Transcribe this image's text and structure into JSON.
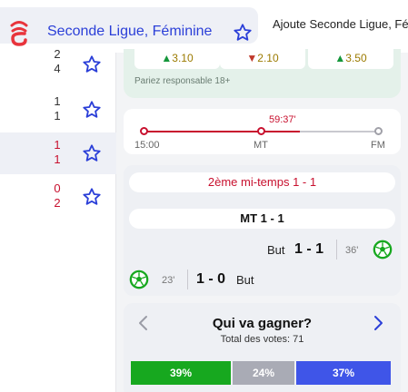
{
  "header": {
    "league_name": "Seconde Ligue, Féminine",
    "add_league": "Ajoute Seconde Ligue, Fém",
    "colors": {
      "brand": "#e8343c",
      "accent": "#2b3fd8"
    }
  },
  "match_list": [
    {
      "home": "2",
      "away": "4",
      "home_color": "#333333",
      "away_color": "#333333",
      "active": false
    },
    {
      "home": "1",
      "away": "1",
      "home_color": "#333333",
      "away_color": "#333333",
      "active": false
    },
    {
      "home": "1",
      "away": "1",
      "home_color": "#c8102e",
      "away_color": "#c8102e",
      "active": true
    },
    {
      "home": "0",
      "away": "2",
      "home_color": "#c8102e",
      "away_color": "#c8102e",
      "active": false
    }
  ],
  "odds": {
    "home": {
      "value": "3.10",
      "trend": "up"
    },
    "draw": {
      "value": "2.10",
      "trend": "down"
    },
    "away": {
      "value": "3.50",
      "trend": "up"
    },
    "responsible": "Pariez responsable 18+"
  },
  "timeline": {
    "current_time": "59:37'",
    "progress": 0.66,
    "labels": {
      "start": "15:00",
      "half": "MT",
      "end": "FM"
    }
  },
  "events": {
    "second_half": "2ème mi-temps 1 - 1",
    "half_time": "MT 1 - 1",
    "goal_away": {
      "label": "But",
      "score": "1 - 1",
      "minute": "36'"
    },
    "goal_home": {
      "label": "But",
      "score": "1 - 0",
      "minute": "23'"
    }
  },
  "poll": {
    "title": "Qui va gagner?",
    "subtitle": "Total des votes: 71",
    "home": {
      "pct": "39%",
      "value": 39,
      "color": "#17a81f"
    },
    "draw": {
      "pct": "24%",
      "value": 24,
      "color": "#a9abb5"
    },
    "away": {
      "pct": "37%",
      "value": 37,
      "color": "#3f55e8"
    }
  }
}
